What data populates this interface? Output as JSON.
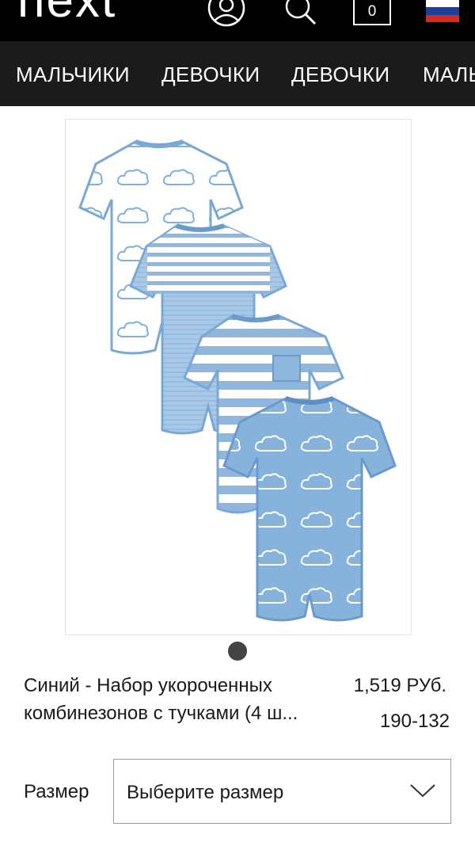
{
  "header": {
    "logo_text": "next",
    "bag_count": "0",
    "icons": [
      "account-icon",
      "search-icon",
      "bag-icon",
      "russia-flag-icon"
    ],
    "flag_colors": [
      "#ffffff",
      "#1c3f9e",
      "#d52b1e"
    ]
  },
  "nav": {
    "items": [
      {
        "label": "МАЛЬЧИКИ"
      },
      {
        "label": "ДЕВОЧКИ"
      },
      {
        "label": "ДЕВОЧКИ"
      },
      {
        "label": "МАЛЬ"
      }
    ]
  },
  "product": {
    "image_alt": "Blue rompers with cloud and stripe prints",
    "carousel_dots": 1,
    "title_line1": "Синий - Набор укороченных",
    "title_line2": "комбинезонов с тучками (4 ш...",
    "price": "1,519 РУб.",
    "size_range": "190-132"
  },
  "size_picker": {
    "label": "Размер",
    "placeholder": "Выберите размер"
  },
  "colors": {
    "header_bg": "#000000",
    "nav_bg": "#1b1b1b",
    "romper_blue": "#8fb6dc",
    "romper_dark_blue": "#6a9acb"
  }
}
